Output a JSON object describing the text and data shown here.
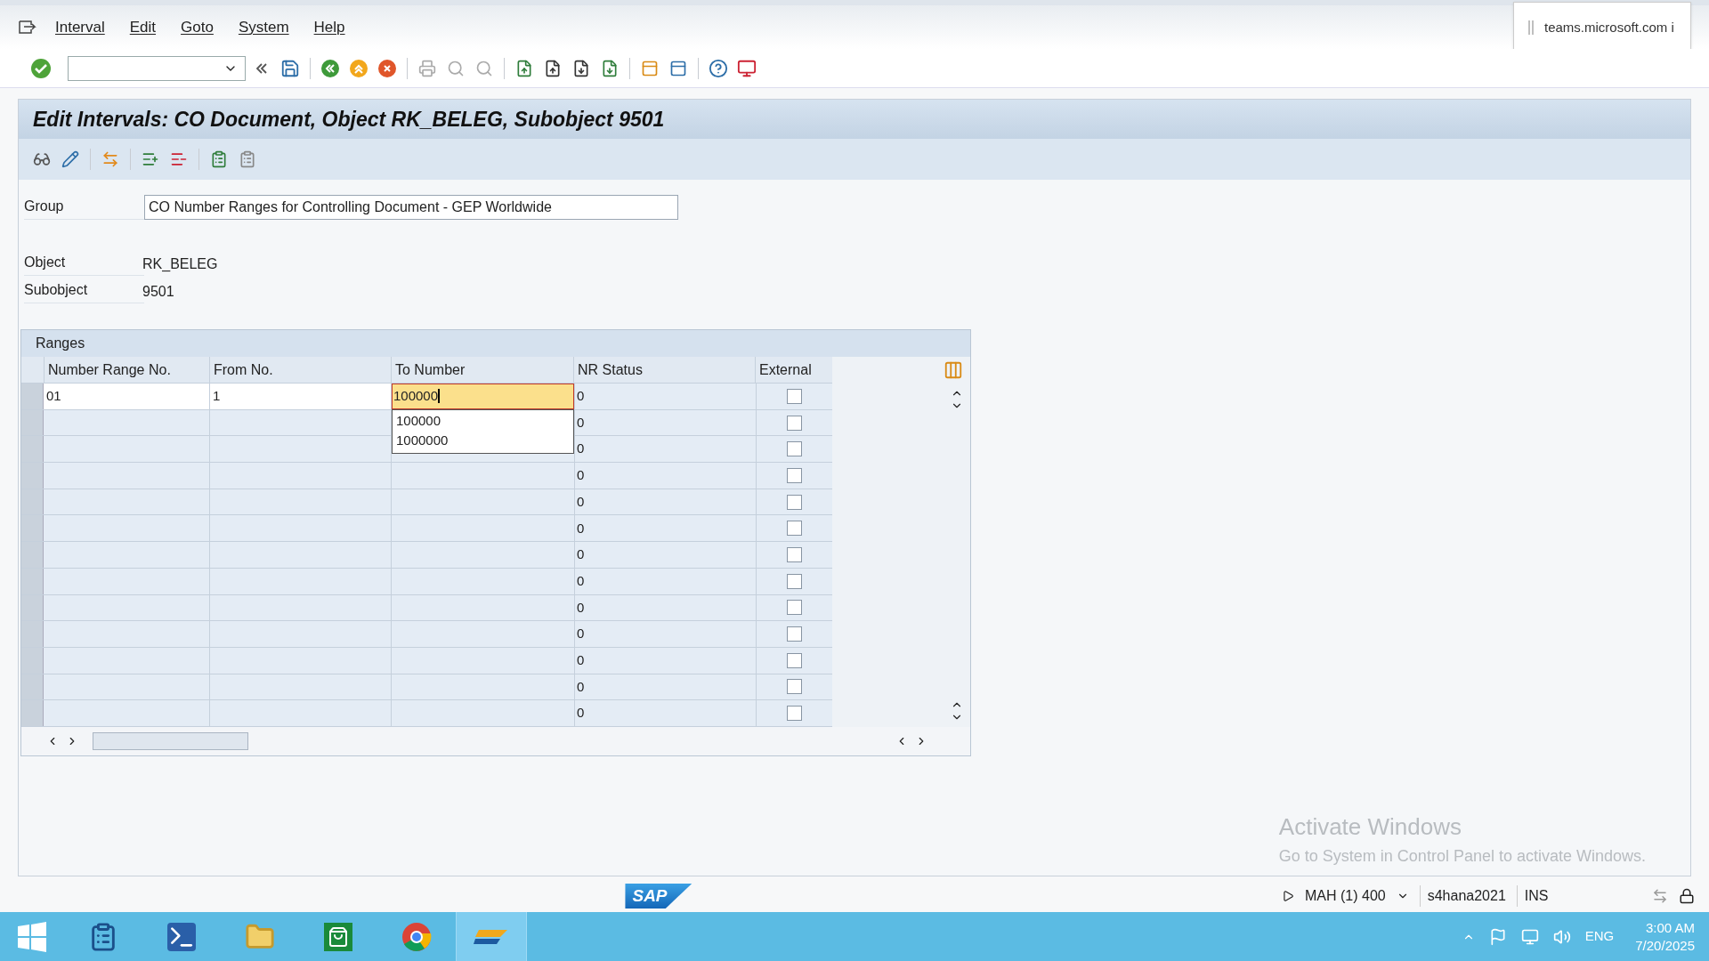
{
  "menu": [
    "Interval",
    "Edit",
    "Goto",
    "System",
    "Help"
  ],
  "notification": {
    "text": "teams.microsoft.com i"
  },
  "title": "Edit Intervals: CO Document, Object RK_BELEG, Subobject 9501",
  "fields": [
    {
      "label": "Group",
      "value": "CO Number Ranges for Controlling Document - GEP Worldwide",
      "kind": "input"
    },
    {
      "label": "Object",
      "value": "RK_BELEG",
      "kind": "display"
    },
    {
      "label": "Subobject",
      "value": "9501",
      "kind": "display"
    }
  ],
  "ranges": {
    "title": "Ranges",
    "columns": [
      "Number Range No.",
      "From No.",
      "To Number",
      "NR Status",
      "External"
    ],
    "rows": [
      {
        "number": "01",
        "from": "1",
        "to": "100000",
        "status": "0",
        "external": false,
        "editing": true
      },
      {
        "status": "0",
        "external": false,
        "editing": false
      },
      {
        "status": "0",
        "external": false,
        "editing": false
      },
      {
        "status": "0",
        "external": false,
        "editing": false
      },
      {
        "status": "0",
        "external": false,
        "editing": false
      },
      {
        "status": "0",
        "external": false,
        "editing": false
      },
      {
        "status": "0",
        "external": false,
        "editing": false
      },
      {
        "status": "0",
        "external": false,
        "editing": false
      },
      {
        "status": "0",
        "external": false,
        "editing": false
      },
      {
        "status": "0",
        "external": false,
        "editing": false
      },
      {
        "status": "0",
        "external": false,
        "editing": false
      },
      {
        "status": "0",
        "external": false,
        "editing": false
      },
      {
        "status": "0",
        "external": false,
        "editing": false
      }
    ],
    "suggestions": [
      "100000",
      "1000000"
    ]
  },
  "activation": {
    "title": "Activate Windows",
    "text": "Go to System in Control Panel to activate Windows."
  },
  "status_bar": {
    "logo": "SAP",
    "session": "MAH (1) 400",
    "server": "s4hana2021",
    "mode": "INS"
  },
  "taskbar": {
    "language": "ENG",
    "time": "3:00 AM",
    "date": "7/20/2025"
  }
}
